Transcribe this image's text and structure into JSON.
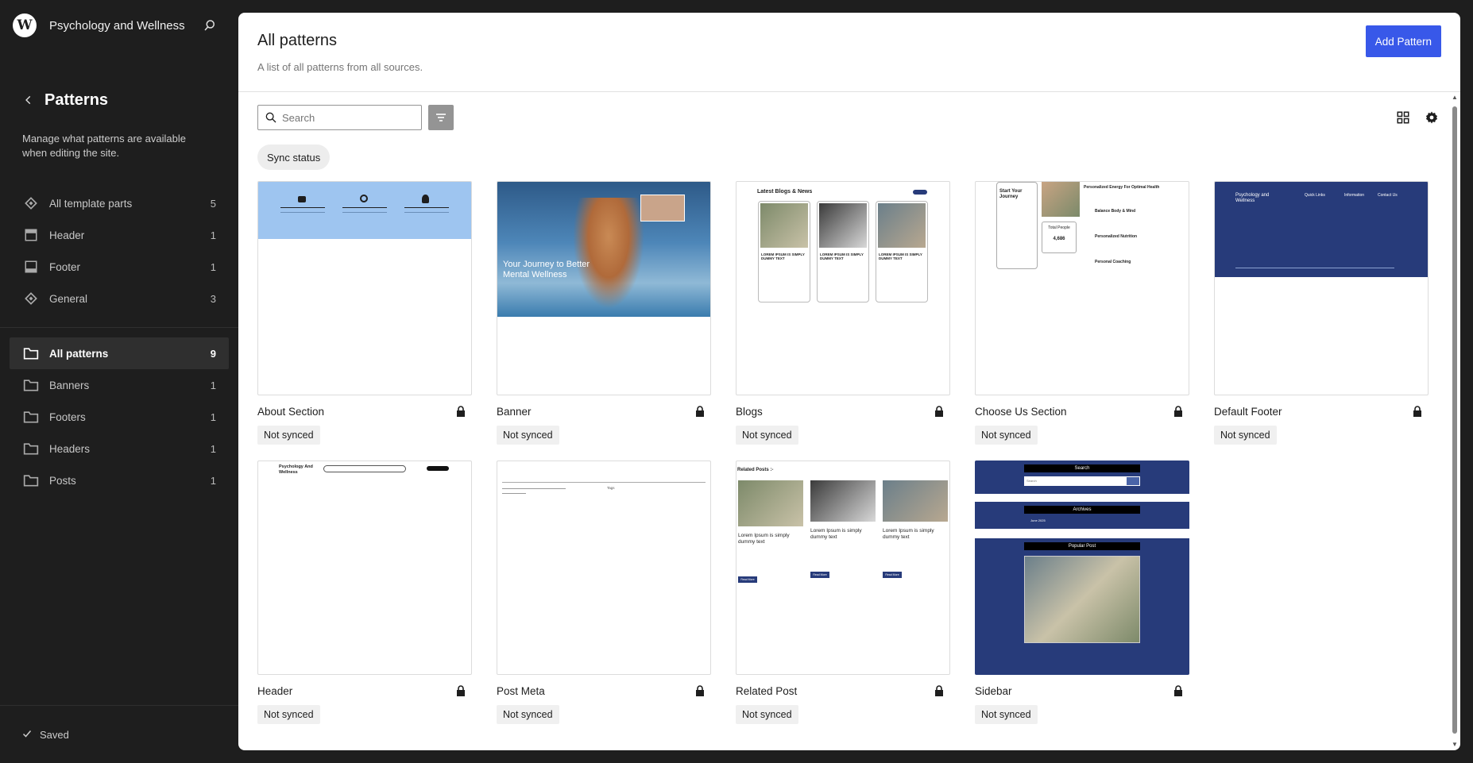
{
  "sidebar": {
    "site_title": "Psychology and Wellness",
    "section_title": "Patterns",
    "section_description": "Manage what patterns are available when editing the site.",
    "template_parts": [
      {
        "label": "All template parts",
        "count": "5",
        "icon": "symbol-icon"
      },
      {
        "label": "Header",
        "count": "1",
        "icon": "header-icon"
      },
      {
        "label": "Footer",
        "count": "1",
        "icon": "footer-icon"
      },
      {
        "label": "General",
        "count": "3",
        "icon": "symbol-icon"
      }
    ],
    "pattern_categories": [
      {
        "label": "All patterns",
        "count": "9",
        "active": true
      },
      {
        "label": "Banners",
        "count": "1"
      },
      {
        "label": "Footers",
        "count": "1"
      },
      {
        "label": "Headers",
        "count": "1"
      },
      {
        "label": "Posts",
        "count": "1"
      }
    ],
    "saved_label": "Saved"
  },
  "main": {
    "title": "All patterns",
    "subtitle": "A list of all patterns from all sources.",
    "add_button": "Add Pattern",
    "search_placeholder": "Search",
    "filter_chip": "Sync status",
    "patterns": [
      {
        "title": "About Section",
        "status": "Not synced"
      },
      {
        "title": "Banner",
        "status": "Not synced"
      },
      {
        "title": "Blogs",
        "status": "Not synced"
      },
      {
        "title": "Choose Us Section",
        "status": "Not synced"
      },
      {
        "title": "Default Footer",
        "status": "Not synced"
      },
      {
        "title": "Header",
        "status": "Not synced"
      },
      {
        "title": "Post Meta",
        "status": "Not synced"
      },
      {
        "title": "Related Post",
        "status": "Not synced"
      },
      {
        "title": "Sidebar",
        "status": "Not synced"
      }
    ]
  },
  "previews": {
    "banner_heading": "Your Journey to Better Mental Wellness",
    "blogs_heading": "Latest Blogs & News",
    "blog_card_title": "LOREM IPSUM IS SIMPLY DUMMY TEXT",
    "choose_heading": "Start Your Journey",
    "choose_item1": "Personalized Energy For Optimal Health",
    "choose_item2": "Balance Body & Mind",
    "choose_item3": "Personalized Nutrition",
    "choose_item4": "Personal Coaching",
    "total_people_label": "Total People",
    "total_people_value": "4,686",
    "footer_brand": "Psychology and Wellness",
    "footer_col1": "Quick Links",
    "footer_col2": "Information",
    "footer_col3": "Contact Us",
    "header_brand": "Psychology And Wellness",
    "related_heading": "Related Posts :-",
    "related_post_title": "Lorem Ipsum is simply dummy text",
    "read_more": "Read More",
    "sidebar_search": "Search",
    "sidebar_search_placeholder": "Search",
    "sidebar_archives": "Archives",
    "sidebar_archive_item": "June 2025",
    "sidebar_popular": "Popular Post",
    "tags_label": "Tags"
  },
  "colors": {
    "accent": "#3858e9",
    "sidebar_bg": "#1e1e1e",
    "theme_navy": "#273b7a",
    "about_bg": "#9ec5f0"
  }
}
